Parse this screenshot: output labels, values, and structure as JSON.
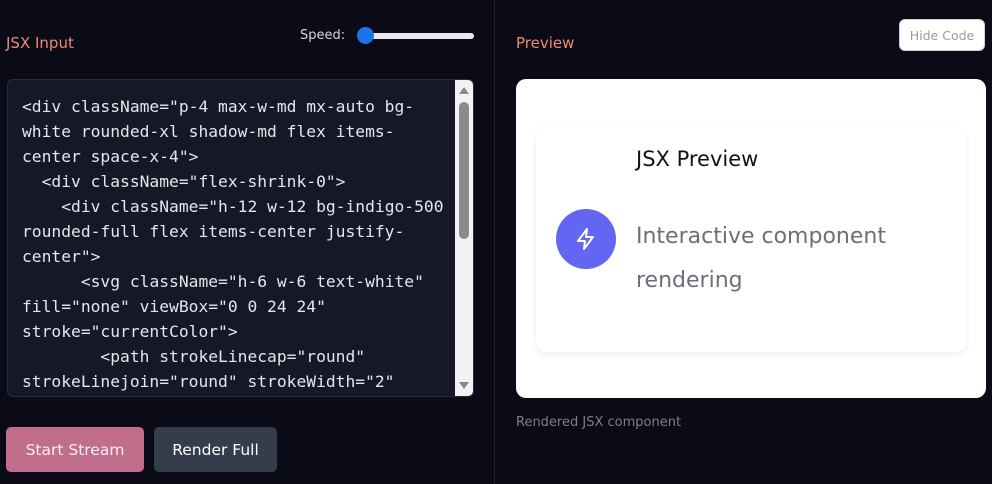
{
  "left": {
    "title": "JSX Input",
    "speed_label": "Speed:",
    "speed_value": 0.0,
    "code": "<div className=\"p-4 max-w-md mx-auto bg-white rounded-xl shadow-md flex items-center space-x-4\">\n  <div className=\"flex-shrink-0\">\n    <div className=\"h-12 w-12 bg-indigo-500 rounded-full flex items-center justify-center\">\n      <svg className=\"h-6 w-6 text-white\" fill=\"none\" viewBox=\"0 0 24 24\" stroke=\"currentColor\">\n        <path strokeLinecap=\"round\" strokeLinejoin=\"round\" strokeWidth=\"2\"",
    "buttons": {
      "start_stream": "Start Stream",
      "render_full": "Render Full"
    }
  },
  "right": {
    "title": "Preview",
    "hide_code": "Hide Code",
    "card": {
      "title": "JSX Preview",
      "description": "Interactive component rendering",
      "icon": "lightning-bolt-icon",
      "icon_color": "#6366f1"
    },
    "caption": "Rendered JSX component"
  },
  "colors": {
    "accent_title": "#f08a6e",
    "start_button": "#c06e8b",
    "render_button": "#353c4b",
    "slider": "#1a73e8"
  }
}
